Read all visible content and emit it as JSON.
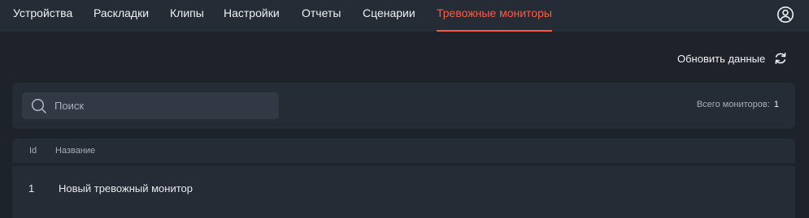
{
  "nav": {
    "items": [
      {
        "label": "Устройства"
      },
      {
        "label": "Раскладки"
      },
      {
        "label": "Клипы"
      },
      {
        "label": "Настройки"
      },
      {
        "label": "Отчеты"
      },
      {
        "label": "Сценарии"
      },
      {
        "label": "Тревожные мониторы",
        "active": true
      }
    ],
    "accent_color": "#ff5a3c",
    "profile_icon": "user-circle-icon"
  },
  "toolbar": {
    "refresh_label": "Обновить данные",
    "refresh_icon": "refresh-icon"
  },
  "search": {
    "placeholder": "Поиск",
    "value": "",
    "icon": "search-icon"
  },
  "summary": {
    "total_label": "Всего мониторов:",
    "total_count": "1"
  },
  "table": {
    "columns": [
      "Id",
      "Название"
    ],
    "rows": [
      {
        "id": "1",
        "name": "Новый тревожный монитор"
      }
    ]
  }
}
